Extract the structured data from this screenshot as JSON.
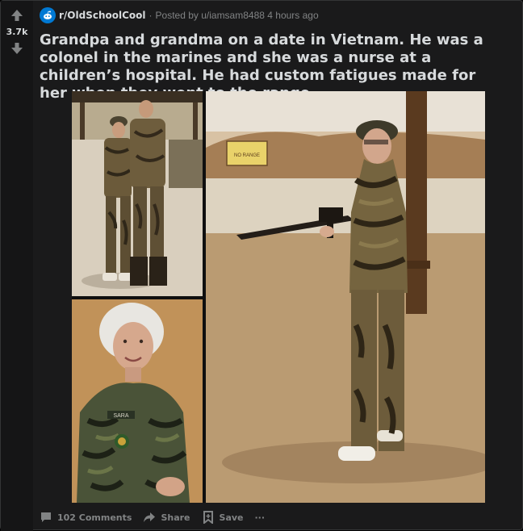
{
  "vote": {
    "score": "3.7k"
  },
  "post": {
    "subreddit": "r/OldSchoolCool",
    "separator": "·",
    "posted_by": "Posted by u/iamsam8488 4 hours ago",
    "title": "Grandpa and grandma on a date in Vietnam. He was a colonel in the marines and she was a nurse at a children’s hospital. He had custom fatigues made for her when they went to the range."
  },
  "image": {
    "sign_text": "NO RANGE",
    "name_tape": "SARA"
  },
  "actions": {
    "comments": "102 Comments",
    "share": "Share",
    "save": "Save",
    "more": "···"
  },
  "colors": {
    "card_bg": "#1a1a1b",
    "text": "#d7dadc",
    "muted": "#818384",
    "subreddit_icon": "#0079d3"
  }
}
